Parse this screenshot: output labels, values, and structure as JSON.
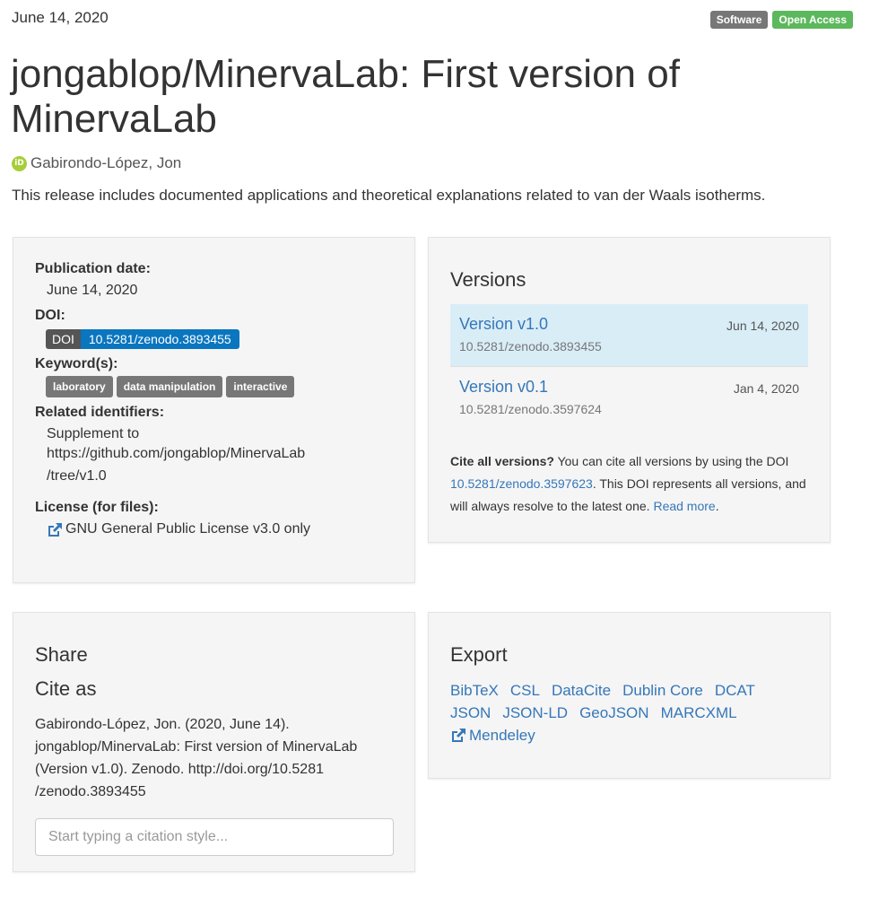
{
  "header": {
    "date": "June 14, 2020",
    "badges": {
      "software": "Software",
      "open_access": "Open Access"
    },
    "title": "jongablop/MinervaLab: First version of MinervaLab",
    "creator": "Gabirondo-López, Jon",
    "description": "This release includes documented applications and theoretical explanations related to van der Waals isotherms."
  },
  "meta": {
    "pub_date_label": "Publication date:",
    "pub_date": "June 14, 2020",
    "doi_label": "DOI:",
    "doi_prefix": "DOI",
    "doi": "10.5281/zenodo.3893455",
    "keywords_label": "Keyword(s):",
    "keywords": [
      "laboratory",
      "data manipulation",
      "interactive"
    ],
    "related_label": "Related identifiers:",
    "related_relation": "Supplement to",
    "related_link_line1": "https://github.com/jongablop/MinervaLab",
    "related_link_line2": "/tree/v1.0",
    "license_label": "License (for files):",
    "license": "GNU General Public License v3.0 only"
  },
  "versions": {
    "title": "Versions",
    "items": [
      {
        "name": "Version v1.0",
        "doi": "10.5281/zenodo.3893455",
        "date": "Jun 14, 2020"
      },
      {
        "name": "Version v0.1",
        "doi": "10.5281/zenodo.3597624",
        "date": "Jan 4, 2020"
      }
    ],
    "cite_all_bold": "Cite all versions?",
    "cite_all_text1": " You can cite all versions by using the DOI ",
    "cite_all_doi": "10.5281/zenodo.3597623",
    "cite_all_text2": ". This DOI represents all versions, and will always resolve to the latest one. ",
    "read_more": "Read more",
    "period": "."
  },
  "share": {
    "title": "Share",
    "cite_as_title": "Cite as",
    "citation_line1": "Gabirondo-López, Jon. (2020, June 14).",
    "citation_line2": "jongablop/MinervaLab: First version of MinervaLab",
    "citation_line3": "(Version v1.0). Zenodo. http://doi.org/10.5281",
    "citation_line4": "/zenodo.3893455",
    "placeholder": "Start typing a citation style..."
  },
  "export": {
    "title": "Export",
    "formats": [
      "BibTeX",
      "CSL",
      "DataCite",
      "Dublin Core",
      "DCAT",
      "JSON",
      "JSON-LD",
      "GeoJSON",
      "MARCXML"
    ],
    "mendeley": "Mendeley"
  },
  "colors": {
    "accent": "#3577b8",
    "open_access": "#5cb85c",
    "doi_blue": "#0a76bf",
    "active_version": "#d9edf7"
  },
  "icons": {
    "orcid": "orcid-icon",
    "external_link": "external-link-icon"
  }
}
